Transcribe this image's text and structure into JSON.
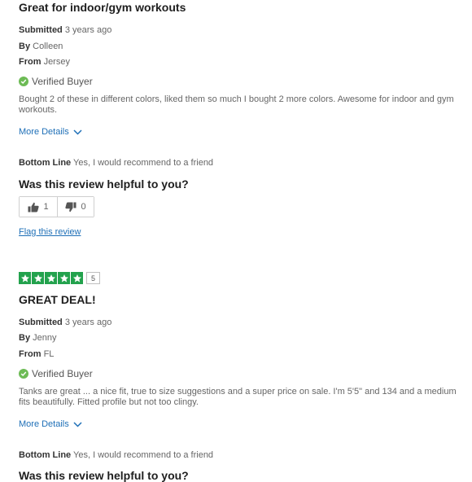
{
  "reviews": [
    {
      "title": "Great for indoor/gym workouts",
      "submitted_label": "Submitted",
      "submitted_value": "3 years ago",
      "by_label": "By",
      "by_value": "Colleen",
      "from_label": "From",
      "from_value": "Jersey",
      "verified": "Verified Buyer",
      "body": "Bought 2 of these in different colors, liked them so much I bought 2 more colors. Awesome for indoor and gym workouts.",
      "more_details": "More Details",
      "bottom_line_label": "Bottom Line",
      "bottom_line_value": "Yes, I would recommend to a friend",
      "helpful_question": "Was this review helpful to you?",
      "helpful_yes": "1",
      "helpful_no": "0",
      "flag": "Flag this review"
    },
    {
      "rating": 5,
      "rating_badge": "5",
      "title": "GREAT DEAL!",
      "submitted_label": "Submitted",
      "submitted_value": "3 years ago",
      "by_label": "By",
      "by_value": "Jenny",
      "from_label": "From",
      "from_value": "FL",
      "verified": "Verified Buyer",
      "body": "Tanks are great ... a nice fit, true to size suggestions and a super price on sale. I'm 5'5\" and 134 and a medium fits beautifully. Fitted profile but not too clingy.",
      "more_details": "More Details",
      "bottom_line_label": "Bottom Line",
      "bottom_line_value": "Yes, I would recommend to a friend",
      "helpful_question": "Was this review helpful to you?"
    }
  ],
  "colors": {
    "star_green": "#23a24d",
    "verified_green": "#6dbb55",
    "link_blue": "#1e6fb7"
  },
  "icons": {
    "verified": "check-circle-icon",
    "expand": "chevron-down-icon",
    "vote_up": "thumbs-up-icon",
    "vote_down": "thumbs-down-icon",
    "rating": "star-icon"
  }
}
